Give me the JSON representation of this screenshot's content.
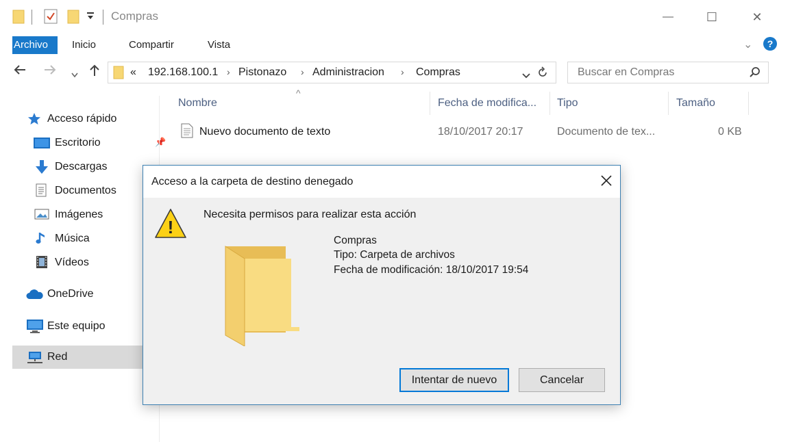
{
  "window": {
    "title": "Compras",
    "minimize_glyph": "—",
    "maximize_glyph": "☐",
    "close_glyph": "✕"
  },
  "ribbon": {
    "tabs": [
      "Archivo",
      "Inicio",
      "Compartir",
      "Vista"
    ],
    "chevron": "⌄",
    "help": "?"
  },
  "address": {
    "overflow": "«",
    "crumbs": [
      "192.168.100.1",
      "Pistonazo",
      "Administracion",
      "Compras"
    ],
    "search_placeholder": "Buscar en Compras"
  },
  "sidebar": {
    "items": [
      {
        "label": "Acceso rápido",
        "icon": "star-icon"
      },
      {
        "label": "Escritorio",
        "icon": "desktop-icon"
      },
      {
        "label": "Descargas",
        "icon": "download-icon"
      },
      {
        "label": "Documentos",
        "icon": "document-icon"
      },
      {
        "label": "Imágenes",
        "icon": "image-icon"
      },
      {
        "label": "Música",
        "icon": "music-icon"
      },
      {
        "label": "Vídeos",
        "icon": "video-icon"
      },
      {
        "label": "OneDrive",
        "icon": "cloud-icon"
      },
      {
        "label": "Este equipo",
        "icon": "computer-icon"
      },
      {
        "label": "Red",
        "icon": "network-icon"
      }
    ],
    "selected": "Red"
  },
  "file_list": {
    "columns": [
      "Nombre",
      "Fecha de modifica...",
      "Tipo",
      "Tamaño"
    ],
    "rows": [
      {
        "name": "Nuevo documento de texto",
        "date": "18/10/2017 20:17",
        "type": "Documento de tex...",
        "size": "0 KB"
      }
    ]
  },
  "dialog": {
    "title": "Acceso a la carpeta de destino denegado",
    "message": "Necesita permisos para realizar esta acción",
    "item_name": "Compras",
    "item_type": "Tipo: Carpeta de archivos",
    "item_date": "Fecha de modificación: 18/10/2017 19:54",
    "retry_label": "Intentar de nuevo",
    "cancel_label": "Cancelar",
    "warning_glyph": "!"
  },
  "colors": {
    "accent": "#1979ca",
    "folder": "#f7d774",
    "dialog_border": "#3c7fb1"
  }
}
